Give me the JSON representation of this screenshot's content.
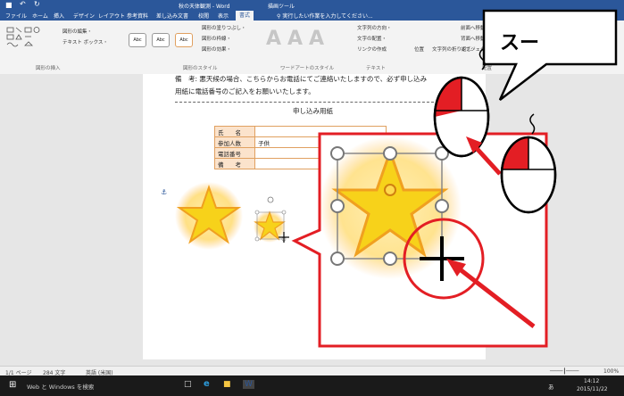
{
  "window": {
    "title": "秋の天体観測 - Word",
    "tool_tab": "描画ツール"
  },
  "tabs": [
    "ファイル",
    "ホーム",
    "挿入",
    "デザイン",
    "レイアウト",
    "参考資料",
    "差し込み文書",
    "校閲",
    "表示",
    "書式"
  ],
  "tell_me": "実行したい作業を入力してください...",
  "ribbon": {
    "insert_shapes": {
      "edit_shape": "図形の編集・",
      "text_box": "テキスト ボックス・",
      "label": "図形の挿入"
    },
    "shape_styles": {
      "style_sample": "Abc",
      "fill": "図形の塗りつぶし・",
      "outline": "図形の枠線・",
      "effects": "図形の効果・",
      "label": "図形のスタイル"
    },
    "wordart": {
      "label": "ワードアートのスタイル"
    },
    "text": {
      "direction": "文字列の方向・",
      "align": "文字の配置・",
      "link": "リンクの作成",
      "label": "テキスト"
    },
    "arrange": {
      "position": "位置",
      "wrap": "文字列の折り返し・",
      "forward": "前面へ移動",
      "backward": "背面へ移動",
      "object": "オブジェクト",
      "label": "配置"
    }
  },
  "document": {
    "line1": "備　考: 悪天候の場合、こちらからお電話にてご連絡いたしますので、必ず申し込み",
    "line2": "用紙に電話番号のご記入をお願いいたします。",
    "form_title": "申し込み用紙",
    "form_rows": [
      {
        "key": "氏　　名",
        "value": ""
      },
      {
        "key": "参加人数",
        "value": "子供"
      },
      {
        "key": "電話番号",
        "value": ""
      },
      {
        "key": "備　　考",
        "value": ""
      }
    ]
  },
  "callout": {
    "text": "スー"
  },
  "status": {
    "page": "1/1 ページ",
    "words": "284 文字",
    "lang": "英語 (米国)",
    "zoom": "100%"
  },
  "taskbar": {
    "search": "Web と Windows を検索",
    "time": "14:12",
    "date": "2015/11/22",
    "ime": "あ"
  }
}
